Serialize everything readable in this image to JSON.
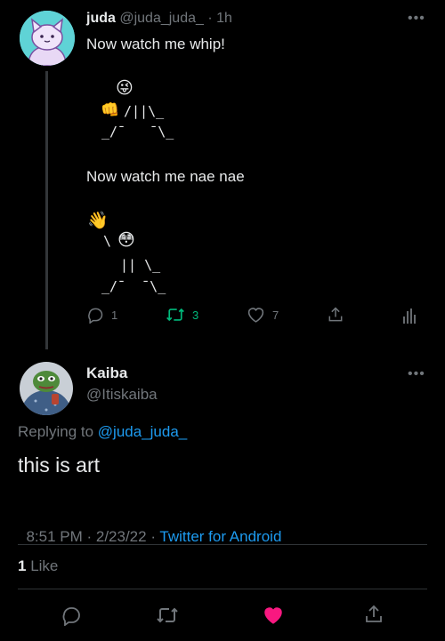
{
  "tweet": {
    "author_name": "juda",
    "author_handle": "@juda_juda_",
    "time": "· 1h",
    "line1": "Now watch me whip!",
    "whip_face": "😜",
    "whip_fist": "👊",
    "whip_row2": "/||\\_",
    "whip_row3": "_/¯   ¯\\_",
    "line2": "Now watch me nae nae",
    "nae_hand": "👋",
    "nae_row2_prefix": "\\",
    "nae_face": "😳",
    "nae_row3": "|| \\_",
    "nae_row4": "_/¯  ¯\\_",
    "reply_count": "1",
    "retweet_count": "3",
    "like_count": "7"
  },
  "reply": {
    "author_name": "Kaiba",
    "author_handle": "@Itiskaiba",
    "replying_to_label": "Replying to",
    "replying_to_handle": "@juda_juda_",
    "text": "this is art",
    "timestamp": "8:51 PM · 2/23/22 · ",
    "source": "Twitter for Android",
    "likes_count": "1",
    "likes_label": "Like"
  },
  "colors": {
    "background": "#000000",
    "link_blue": "#1d9bf0",
    "retweet_green": "#00ba7c",
    "like_pink": "#f91880",
    "muted": "#71767b"
  }
}
